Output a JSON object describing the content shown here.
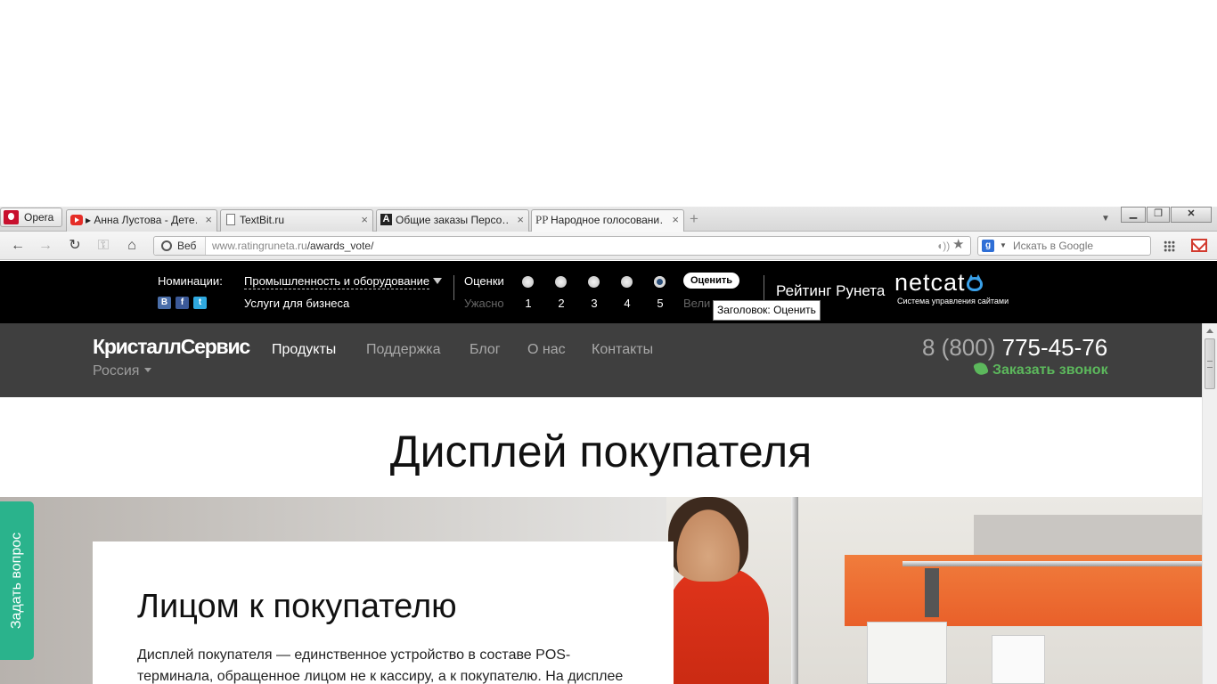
{
  "browser": {
    "menu_label": "Opera",
    "tabs": [
      {
        "title": "▸ Анна Лустова - Дете…",
        "icon": "youtube-icon"
      },
      {
        "title": "TextBit.ru",
        "icon": "document-icon"
      },
      {
        "title": "Общие заказы Персо…",
        "icon": "letter-a-icon"
      },
      {
        "title": "Народное голосовани…",
        "icon": "ratingruneta-icon",
        "active": true
      }
    ],
    "tab_close_glyph": "×",
    "new_tab_glyph": "+",
    "address": {
      "chip_label": "Веб",
      "host": "www.ratingruneta.ru",
      "path": "/awards_vote/"
    },
    "search": {
      "placeholder": "Искать в Google",
      "engine_letter": "g"
    }
  },
  "vote_bar": {
    "nominations_label": "Номинации:",
    "nomination_selected": "Промышленность и оборудование",
    "nomination_sub": "Услуги для бизнеса",
    "social": [
      "В",
      "f",
      "t"
    ],
    "ratings_label": "Оценки",
    "worst_label": "Ужасно",
    "best_label": "Вели",
    "ratings": [
      "1",
      "2",
      "3",
      "4",
      "5"
    ],
    "selected_rating": "5",
    "rate_button": "Оценить",
    "tooltip": "Заголовок: Оценить",
    "rating_title": "Рейтинг Рунета",
    "cms_logo": "netcat",
    "cms_tagline": "Система управления сайтами"
  },
  "site": {
    "logo": "КристаллСервис",
    "region": "Россия",
    "nav": [
      "Продукты",
      "Поддержка",
      "Блог",
      "О нас",
      "Контакты"
    ],
    "active_nav": "Продукты",
    "phone_prefix": "8 (800)",
    "phone_number": "775-45-76",
    "callback": "Заказать звонок",
    "callback_color": "#5cb85c"
  },
  "page": {
    "title": "Дисплей покупателя",
    "card_title": "Лицом к покупателю",
    "card_text": "Дисплей покупателя — единственное устройство в составе POS-терминала, обращенное лицом не к кассиру, а к покупателю. На дисплее",
    "ask_button": "Задать вопрос",
    "ask_color": "#2ab38c"
  }
}
